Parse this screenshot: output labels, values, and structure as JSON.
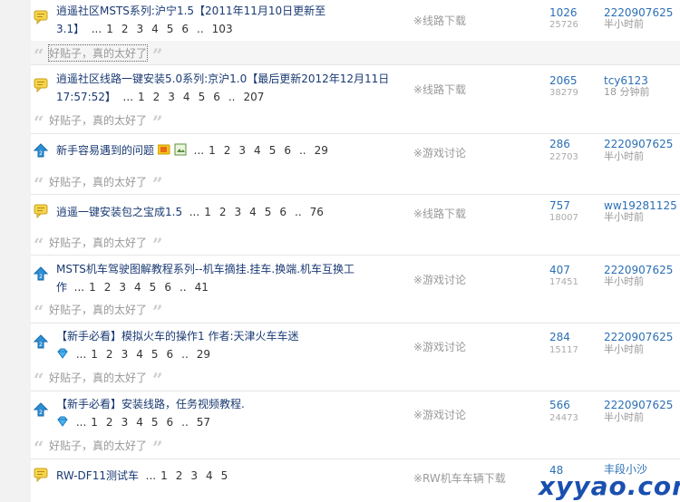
{
  "threads": [
    {
      "title_line1": "逍遥社区MSTS系列:沪宁1.5【2011年11月10日更新至",
      "title_line2": "3.1】",
      "pages": [
        "1",
        "2",
        "3",
        "4",
        "5",
        "6",
        "..",
        "103"
      ],
      "forum": "※线路下载",
      "replies": "1026",
      "views": "25726",
      "last_user": "2220907625",
      "last_time": "半小时前",
      "comment": "好贴子，真的太好了"
    },
    {
      "title_line1": "逍遥社区线路一键安装5.0系列:京沪1.0【最后更新2012年12月11日",
      "title_line2": "17:57:52】",
      "pages": [
        "1",
        "2",
        "3",
        "4",
        "5",
        "6",
        "..",
        "207"
      ],
      "forum": "※线路下载",
      "replies": "2065",
      "views": "38279",
      "last_user": "tcy6123",
      "last_time": "18 分钟前",
      "comment": "好贴子，真的太好了"
    },
    {
      "title_line1": "新手容易遇到的问题",
      "pages": [
        "1",
        "2",
        "3",
        "4",
        "5",
        "6",
        "..",
        "29"
      ],
      "forum": "※游戏讨论",
      "replies": "286",
      "views": "22703",
      "last_user": "2220907625",
      "last_time": "半小时前",
      "comment": "好贴子，真的太好了"
    },
    {
      "title_line1": "逍遥一键安装包之宝成1.5",
      "pages": [
        "1",
        "2",
        "3",
        "4",
        "5",
        "6",
        "..",
        "76"
      ],
      "forum": "※线路下载",
      "replies": "757",
      "views": "18007",
      "last_user": "ww19281125",
      "last_time": "半小时前",
      "comment": "好贴子，真的太好了"
    },
    {
      "title_line1": "MSTS机车驾驶图解教程系列--机车摘挂.挂车.换端.机车互换工",
      "title_line2": "作",
      "pages": [
        "1",
        "2",
        "3",
        "4",
        "5",
        "6",
        "..",
        "41"
      ],
      "forum": "※游戏讨论",
      "replies": "407",
      "views": "17451",
      "last_user": "2220907625",
      "last_time": "半小时前",
      "comment": "好贴子，真的太好了"
    },
    {
      "title_line1": "【新手必看】模拟火车的操作1 作者:天津火车车迷",
      "pages": [
        "1",
        "2",
        "3",
        "4",
        "5",
        "6",
        "..",
        "29"
      ],
      "forum": "※游戏讨论",
      "replies": "284",
      "views": "15117",
      "last_user": "2220907625",
      "last_time": "半小时前",
      "comment": "好贴子，真的太好了"
    },
    {
      "title_line1": "【新手必看】安装线路，任务视频教程.",
      "pages": [
        "1",
        "2",
        "3",
        "4",
        "5",
        "6",
        "..",
        "57"
      ],
      "forum": "※游戏讨论",
      "replies": "566",
      "views": "24473",
      "last_user": "2220907625",
      "last_time": "半小时前",
      "comment": "好贴子，真的太好了"
    },
    {
      "title_line1": "RW-DF11测试车",
      "pages": [
        "1",
        "2",
        "3",
        "4",
        "5"
      ],
      "forum": "※RW机车车辆下载",
      "replies": "48",
      "last_user": "丰段小沙"
    }
  ],
  "quote_open": "“",
  "quote_close": "”",
  "watermark": "xyyao.com",
  "colors": {
    "link": "#1a3a73",
    "stat": "#2b6fb5",
    "muted": "#999999",
    "watermark": "#1a4fb0"
  }
}
